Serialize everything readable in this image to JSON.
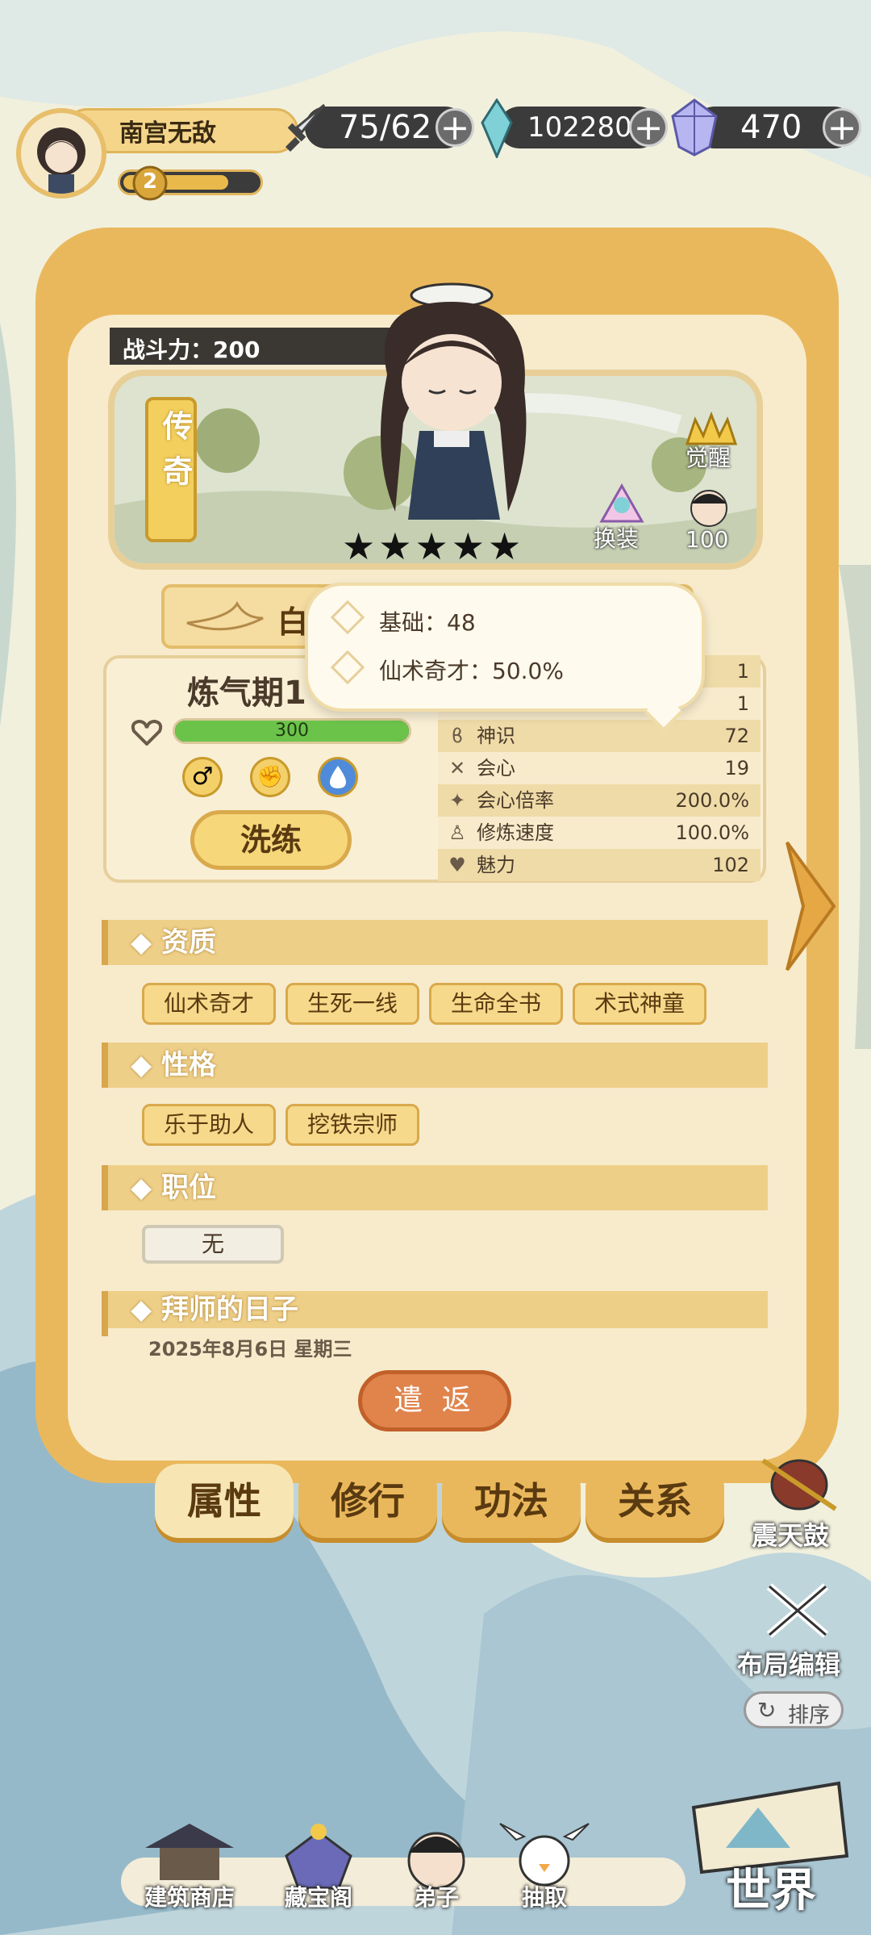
{
  "player": {
    "name": "南宫无敌",
    "level": "2"
  },
  "resources": {
    "stamina": "75/62",
    "spirit_stone": "102280",
    "gem": "470"
  },
  "character": {
    "power_label": "战斗力：200",
    "rarity": "传奇",
    "stars": "★★★★★",
    "awaken_label": "觉醒",
    "outfit_label": "换装",
    "affection_value": "100",
    "name_partial": "白",
    "realm": "炼气期1",
    "hp": "300",
    "hp_fraction": 1.0,
    "refine_button": "洗练"
  },
  "tooltip": {
    "line1": "基础：48",
    "line2": "仙术奇才：50.0%"
  },
  "stats": [
    {
      "label": "",
      "value": "1",
      "icon": ""
    },
    {
      "label": "",
      "value": "1",
      "icon": ""
    },
    {
      "label": "神识",
      "value": "72",
      "icon": "mind-icon"
    },
    {
      "label": "会心",
      "value": "19",
      "icon": "crit-icon"
    },
    {
      "label": "会心倍率",
      "value": "200.0%",
      "icon": "crit-rate-icon"
    },
    {
      "label": "修炼速度",
      "value": "100.0%",
      "icon": "cultivate-icon"
    },
    {
      "label": "魅力",
      "value": "102",
      "icon": "heart-icon"
    }
  ],
  "sections": {
    "aptitude": {
      "title": "◆ 资质",
      "tags": [
        "仙术奇才",
        "生死一线",
        "生命全书",
        "术式神童"
      ]
    },
    "personality": {
      "title": "◆ 性格",
      "tags": [
        "乐于助人",
        "挖铁宗师"
      ]
    },
    "position": {
      "title": "◆ 职位",
      "value": "无"
    },
    "apprentice": {
      "title": "◆ 拜师的日子",
      "date": "2025年8月6日 星期三"
    }
  },
  "dismiss_button": "遣 返",
  "tabs": [
    "属性",
    "修行",
    "功法",
    "关系"
  ],
  "side": {
    "drum": "震天鼓",
    "layout": "布局编辑",
    "sort": "排序"
  },
  "bottom_nav": [
    "建筑商店",
    "藏宝阁",
    "弟子",
    "抽取"
  ],
  "world": "世界",
  "colors": {
    "panel": "#eab85c",
    "hp": "#6cc34a",
    "dismiss": "#e0844c"
  }
}
